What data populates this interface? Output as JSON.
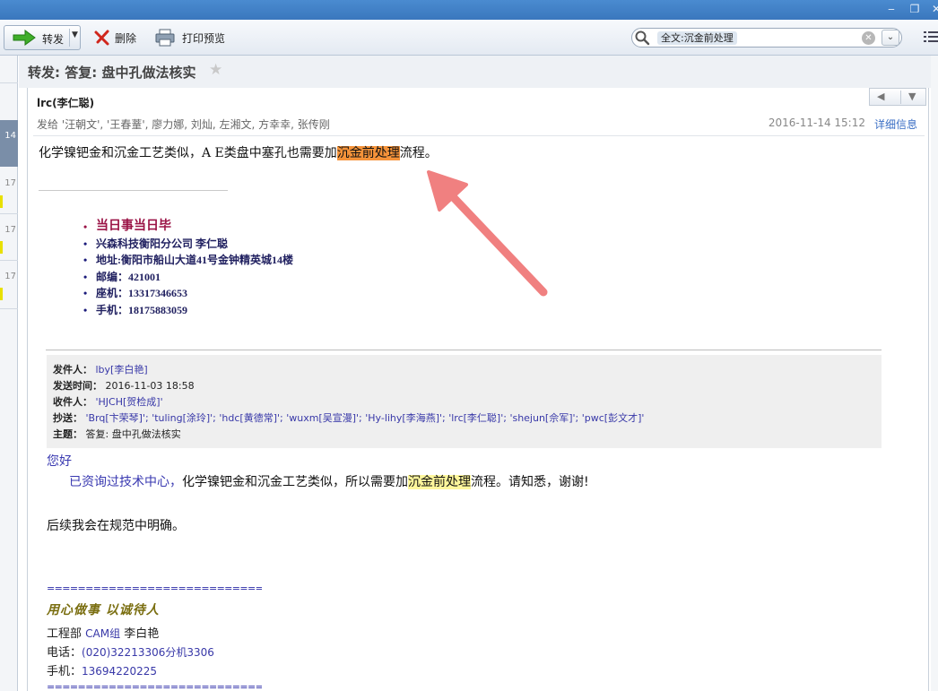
{
  "window": {
    "minimize": "‒",
    "restore": "❐",
    "close": "✕"
  },
  "toolbar": {
    "forward_label": "转发",
    "delete_label": "删除",
    "print_preview_label": "打印预览"
  },
  "search": {
    "tag": "全文:沉金前处理"
  },
  "sidebar": {
    "items": [
      "14",
      "17",
      "17",
      "17"
    ]
  },
  "message": {
    "subject": "转发: 答复: 盘中孔做法核实",
    "sender": "lrc(李仁聪)",
    "recipients": "发给 '汪朝文', '王春蕫', 廖力娜, 刘灿, 左湘文, 方幸幸, 张传刚",
    "datetime": "2016-11-14 15:12",
    "details_link": "详细信息",
    "body_before": "化学镍钯金和沉金工艺类似，A E类盘中塞孔也需要加",
    "body_highlight": "沉金前处理",
    "body_after": "流程。"
  },
  "signature": {
    "lines": [
      "当日事当日毕",
      "兴森科技衡阳分公司   李仁聪",
      "地址:衡阳市船山大道41号金钟精英城14楼",
      "邮编：421001",
      "座机：13317346653",
      "手机：18175883059"
    ]
  },
  "quoted_header": {
    "from_label": "发件人：",
    "from_value": "lby[李白艳]",
    "sent_label": "发送时间：",
    "sent_value": "2016-11-03 18:58",
    "to_label": "收件人：",
    "to_value": "'HJCH[贺检成]'",
    "cc_label": "抄送：",
    "cc_value": "'Brq[卞荣琴]'; 'tuling[涂玲]'; 'hdc[黄德常]'; 'wuxm[吴宣漫]'; 'Hy-lihy[李海燕]'; 'lrc[李仁聪]'; 'shejun[佘军]'; 'pwc[彭文才]'",
    "subject_label": "主题：",
    "subject_value": "答复: 盘中孔做法核实"
  },
  "quoted_body": {
    "greeting": "您好",
    "line_blue": "已资询过技术中心，",
    "line_before": "化学镍钯金和沉金工艺类似，所以需要加",
    "line_highlight": "沉金前处理",
    "line_after": "流程。请知悉，谢谢!",
    "line3": "后续我会在规范中明确。"
  },
  "quoted_signature": {
    "divider": "================================",
    "motto": "用心做事  以诚待人",
    "dept_label": "工程部",
    "dept_group": "CAM组",
    "dept_name": "李白艳",
    "phone_label": "电话：",
    "phone_value": "(020)32213306",
    "phone_ext": "分机3306",
    "mobile_label": "手机：",
    "mobile_value": "13694220225"
  },
  "colors": {
    "highlight_orange": "#f5933a",
    "highlight_yellow": "#fff79c",
    "annotation_arrow": "#f08080"
  }
}
